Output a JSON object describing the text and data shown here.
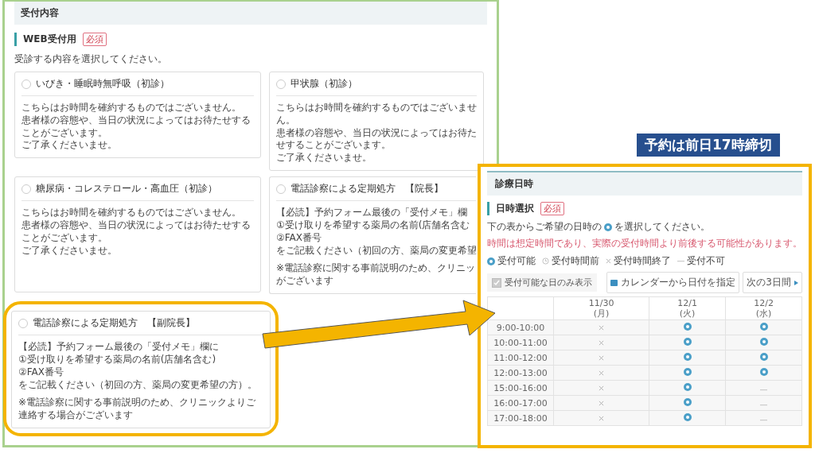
{
  "annotation_label": "予約は前日17時締切",
  "left_panel": {
    "header": "受付内容",
    "section_title": "WEB受付用",
    "required_tag": "必須",
    "instruction": "受診する内容を選択してください。",
    "options": [
      {
        "title": "いびき・睡眠時無呼吸（初診）",
        "selected": false,
        "highlighted": false,
        "paragraphs": [
          [
            "こちらはお時間を確約するものではございません。",
            "患者様の容態や、当日の状況によってはお待たせすることがございます。",
            "ご了承くださいませ。"
          ]
        ]
      },
      {
        "title": "甲状腺（初診）",
        "selected": false,
        "highlighted": false,
        "paragraphs": [
          [
            "こちらはお時間を確約するものではございません。",
            "患者様の容態や、当日の状況によってはお待たせすることがございます。",
            "ご了承くださいませ。"
          ]
        ]
      },
      {
        "title": "糖尿病・コレステロール・高血圧（初診）",
        "selected": false,
        "highlighted": false,
        "paragraphs": [
          [
            "こちらはお時間を確約するものではございません。",
            "患者様の容態や、当日の状況によってはお待たせすることがございます。",
            "ご了承くださいませ。"
          ]
        ]
      },
      {
        "title": "電話診察による定期処方　【院長】",
        "selected": false,
        "highlighted": false,
        "cut": true,
        "paragraphs": [
          [
            "【必読】予約フォーム最後の「受付メモ」欄",
            "①受け取りを希望する薬局の名前(店舗名含む",
            "②FAX番号",
            "をご記載ください（初回の方、薬局の変更希望"
          ],
          [
            "※電話診察に関する事前説明のため、クリニッ",
            "がございます"
          ]
        ]
      },
      {
        "title": "電話診察による定期処方　【副院長】",
        "selected": false,
        "highlighted": true,
        "paragraphs": [
          [
            "【必読】予約フォーム最後の「受付メモ」欄に",
            "①受け取りを希望する薬局の名前(店舗名含む)",
            "②FAX番号",
            "をご記載ください（初回の方、薬局の変更希望の方）。"
          ],
          [
            "※電話診察に関する事前説明のため、クリニックよりご連絡する場合がございます"
          ]
        ]
      }
    ]
  },
  "right_panel": {
    "header": "診療日時",
    "section_title": "日時選択",
    "required_tag": "必須",
    "instruction_before": "下の表からご希望の日時の",
    "instruction_after": "を選択してください。",
    "note": "時間は想定時間であり、実際の受付時間より前後する可能性があります。",
    "legend": [
      {
        "kind": "available",
        "label": "受付可能"
      },
      {
        "kind": "before",
        "label": "受付時間前"
      },
      {
        "kind": "closed",
        "label": "受付時間終了"
      },
      {
        "kind": "unavailable",
        "label": "受付不可"
      }
    ],
    "filter": {
      "label": "受付可能な日のみ表示",
      "checked": true
    },
    "calendar_button": "カレンダーから日付を指定",
    "next_button": "次の3日間",
    "days": [
      {
        "date": "11/30",
        "weekday": "(月)"
      },
      {
        "date": "12/1",
        "weekday": "(火)"
      },
      {
        "date": "12/2",
        "weekday": "(水)"
      }
    ],
    "slots": [
      {
        "time": "9:00-10:00",
        "cells": [
          {
            "kind": "closed"
          },
          {
            "kind": "available"
          },
          {
            "kind": "available"
          }
        ]
      },
      {
        "time": "10:00-11:00",
        "cells": [
          {
            "kind": "closed"
          },
          {
            "kind": "available"
          },
          {
            "kind": "available"
          }
        ]
      },
      {
        "time": "11:00-12:00",
        "cells": [
          {
            "kind": "closed"
          },
          {
            "kind": "available"
          },
          {
            "kind": "available"
          }
        ]
      },
      {
        "time": "12:00-13:00",
        "cells": [
          {
            "kind": "closed"
          },
          {
            "kind": "available"
          },
          {
            "kind": "available"
          }
        ]
      },
      {
        "time": "15:00-16:00",
        "cells": [
          {
            "kind": "closed"
          },
          {
            "kind": "available"
          },
          {
            "kind": "unavailable"
          }
        ]
      },
      {
        "time": "16:00-17:00",
        "cells": [
          {
            "kind": "closed"
          },
          {
            "kind": "available"
          },
          {
            "kind": "unavailable"
          }
        ]
      },
      {
        "time": "17:00-18:00",
        "cells": [
          {
            "kind": "closed"
          },
          {
            "kind": "available"
          },
          {
            "kind": "unavailable"
          }
        ]
      }
    ]
  }
}
